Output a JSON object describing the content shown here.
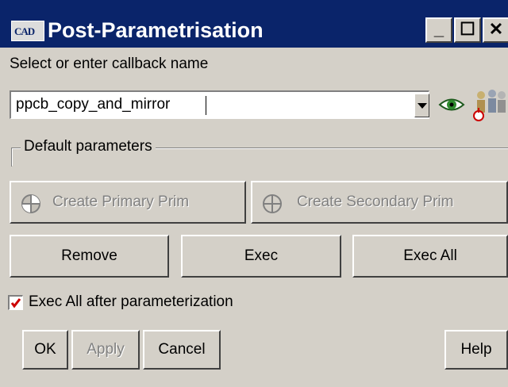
{
  "window": {
    "title": "Post-Parametrisation",
    "icon_text": "CAD",
    "controls": {
      "minimize": "_",
      "maximize": "☐",
      "close": "✕"
    }
  },
  "callback": {
    "label": "Select or enter callback name",
    "value": "ppcb_copy_and_mirror",
    "icons": [
      "dropdown-arrow-icon",
      "eye-icon",
      "people-icon"
    ]
  },
  "params_group": {
    "label": "Default parameters"
  },
  "prim_buttons": {
    "primary_label": "Create Primary Prim",
    "secondary_label": "Create Secondary Prim",
    "enabled": false
  },
  "actions": {
    "remove": "Remove",
    "exec": "Exec",
    "exec_all": "Exec All"
  },
  "exec_after": {
    "label": "Exec All after parameterization",
    "checked": true
  },
  "footer": {
    "ok": "OK",
    "apply": "Apply",
    "cancel": "Cancel",
    "help": "Help"
  },
  "colors": {
    "title_bar": "#0a246a",
    "face": "#d4d0c8",
    "check": "#cc0000"
  }
}
